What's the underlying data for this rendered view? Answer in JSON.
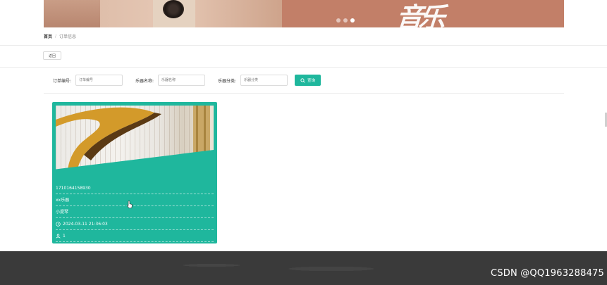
{
  "banner": {
    "headline": "音乐",
    "carousel_count": 3,
    "carousel_active": 3
  },
  "breadcrumb": {
    "home": "首页",
    "separator": "/",
    "current": "订单信息"
  },
  "toolbar": {
    "back_label": "返回"
  },
  "search": {
    "order_no_label": "订单编号:",
    "order_no_placeholder": "订单编号",
    "instrument_name_label": "乐器名称:",
    "instrument_name_placeholder": "乐器名称",
    "instrument_category_label": "乐器分类:",
    "instrument_category_placeholder": "乐器分类",
    "button_label": "查询"
  },
  "card": {
    "order_no": "1710164158930",
    "instrument_name": "xx乐器",
    "category": "小提琴",
    "datetime": "2024-03-11 21:36:03",
    "quantity": "1",
    "icons": {
      "time": "clock-icon",
      "user": "user-icon"
    }
  },
  "watermark": "CSDN @QQ1963288475",
  "colors": {
    "accent": "#1fb79d",
    "footer": "#3a3a3a"
  }
}
